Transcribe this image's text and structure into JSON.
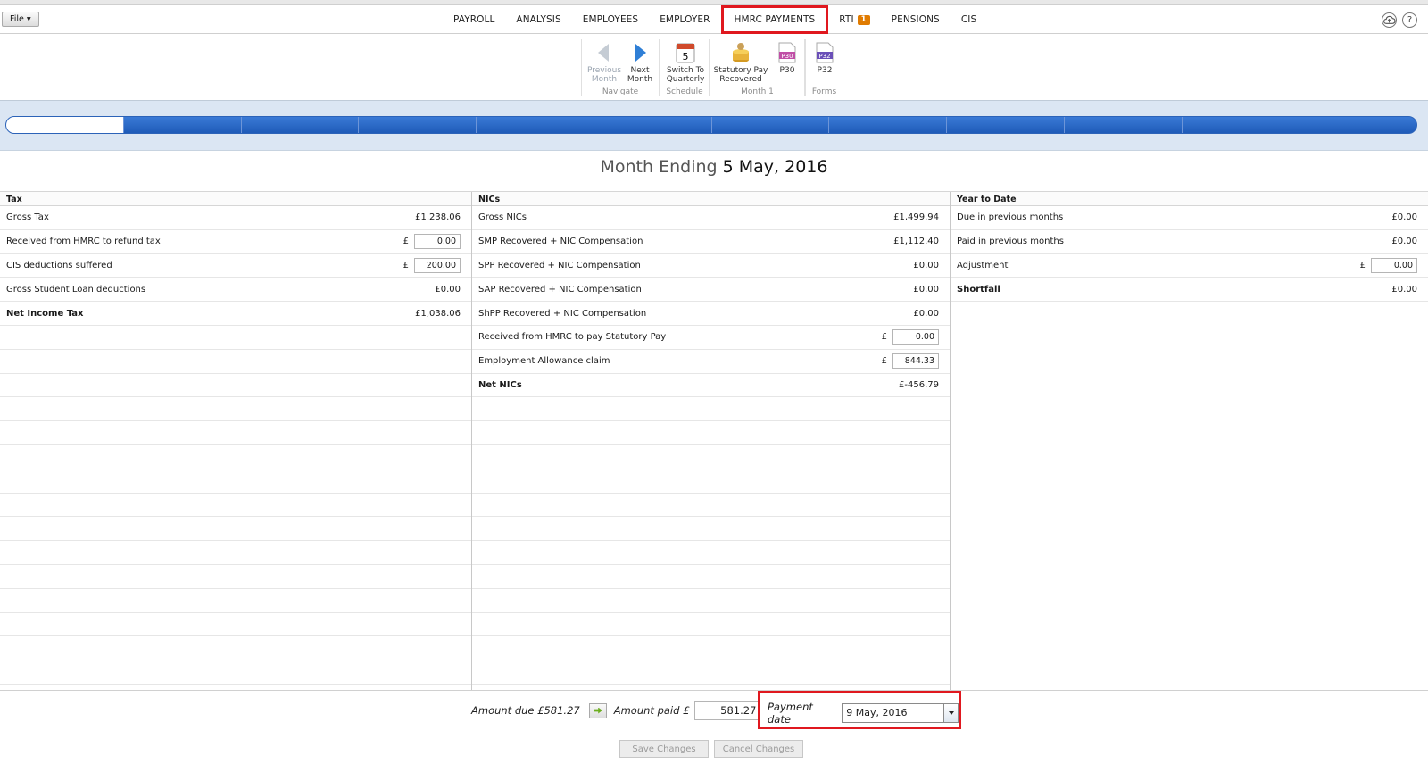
{
  "menu": {
    "file_label": "File ▾",
    "tabs": [
      {
        "label": "PAYROLL"
      },
      {
        "label": "ANALYSIS"
      },
      {
        "label": "EMPLOYEES"
      },
      {
        "label": "EMPLOYER"
      },
      {
        "label": "HMRC PAYMENTS"
      },
      {
        "label": "RTI",
        "badge": "1"
      },
      {
        "label": "PENSIONS"
      },
      {
        "label": "CIS"
      }
    ],
    "help_glyph": "?"
  },
  "ribbon": {
    "groups": [
      {
        "label": "Navigate",
        "buttons": [
          {
            "label1": "Previous",
            "label2": "Month",
            "icon": "left-arrow-icon"
          },
          {
            "label1": "Next",
            "label2": "Month",
            "icon": "right-arrow-icon"
          }
        ]
      },
      {
        "label": "Schedule",
        "buttons": [
          {
            "label1": "Switch To",
            "label2": "Quarterly",
            "icon": "calendar-icon",
            "icon_text": "5"
          }
        ]
      },
      {
        "label": "Month 1",
        "buttons": [
          {
            "label1": "Statutory Pay",
            "label2": "Recovered",
            "icon": "coins-icon"
          },
          {
            "label1": "P30",
            "label2": "",
            "icon": "p30-form-icon",
            "icon_text": "P30"
          }
        ]
      },
      {
        "label": "Forms",
        "buttons": [
          {
            "label1": "P32",
            "label2": "",
            "icon": "p32-form-icon",
            "icon_text": "P32"
          }
        ]
      }
    ]
  },
  "heading": {
    "prefix": "Month Ending",
    "date": "5 May, 2016"
  },
  "tax": {
    "title": "Tax",
    "rows": [
      {
        "label": "Gross Tax",
        "value": "£1,238.06"
      },
      {
        "label": "Received from HMRC to refund tax",
        "currency": "£",
        "input": "0.00"
      },
      {
        "label": "CIS deductions suffered",
        "currency": "£",
        "input": "200.00"
      },
      {
        "label": "Gross Student Loan deductions",
        "value": "£0.00"
      },
      {
        "label": "Net Income Tax",
        "value": "£1,038.06"
      }
    ]
  },
  "nics": {
    "title": "NICs",
    "rows": [
      {
        "label": "Gross NICs",
        "value": "£1,499.94"
      },
      {
        "label": "SMP Recovered + NIC Compensation",
        "value": "£1,112.40"
      },
      {
        "label": "SPP Recovered + NIC Compensation",
        "value": "£0.00"
      },
      {
        "label": "SAP Recovered + NIC Compensation",
        "value": "£0.00"
      },
      {
        "label": "ShPP Recovered + NIC Compensation",
        "value": "£0.00"
      },
      {
        "label": "Received from HMRC to pay Statutory Pay",
        "currency": "£",
        "input": "0.00"
      },
      {
        "label": "Employment Allowance claim",
        "currency": "£",
        "input": "844.33"
      },
      {
        "label": "Net NICs",
        "value": "£-456.79"
      }
    ]
  },
  "ytd": {
    "title": "Year to Date",
    "rows": [
      {
        "label": "Due in previous months",
        "value": "£0.00"
      },
      {
        "label": "Paid in previous months",
        "value": "£0.00"
      },
      {
        "label": "Adjustment",
        "currency": "£",
        "input": "0.00"
      },
      {
        "label": "Shortfall",
        "value": "£0.00"
      }
    ]
  },
  "footer": {
    "amount_due_label": "Amount due £581.27",
    "amount_paid_label": "Amount paid £",
    "amount_paid_value": "581.27",
    "payment_date_label": "Payment date",
    "payment_date_value": "9 May, 2016",
    "save_label": "Save Changes",
    "cancel_label": "Cancel Changes"
  }
}
